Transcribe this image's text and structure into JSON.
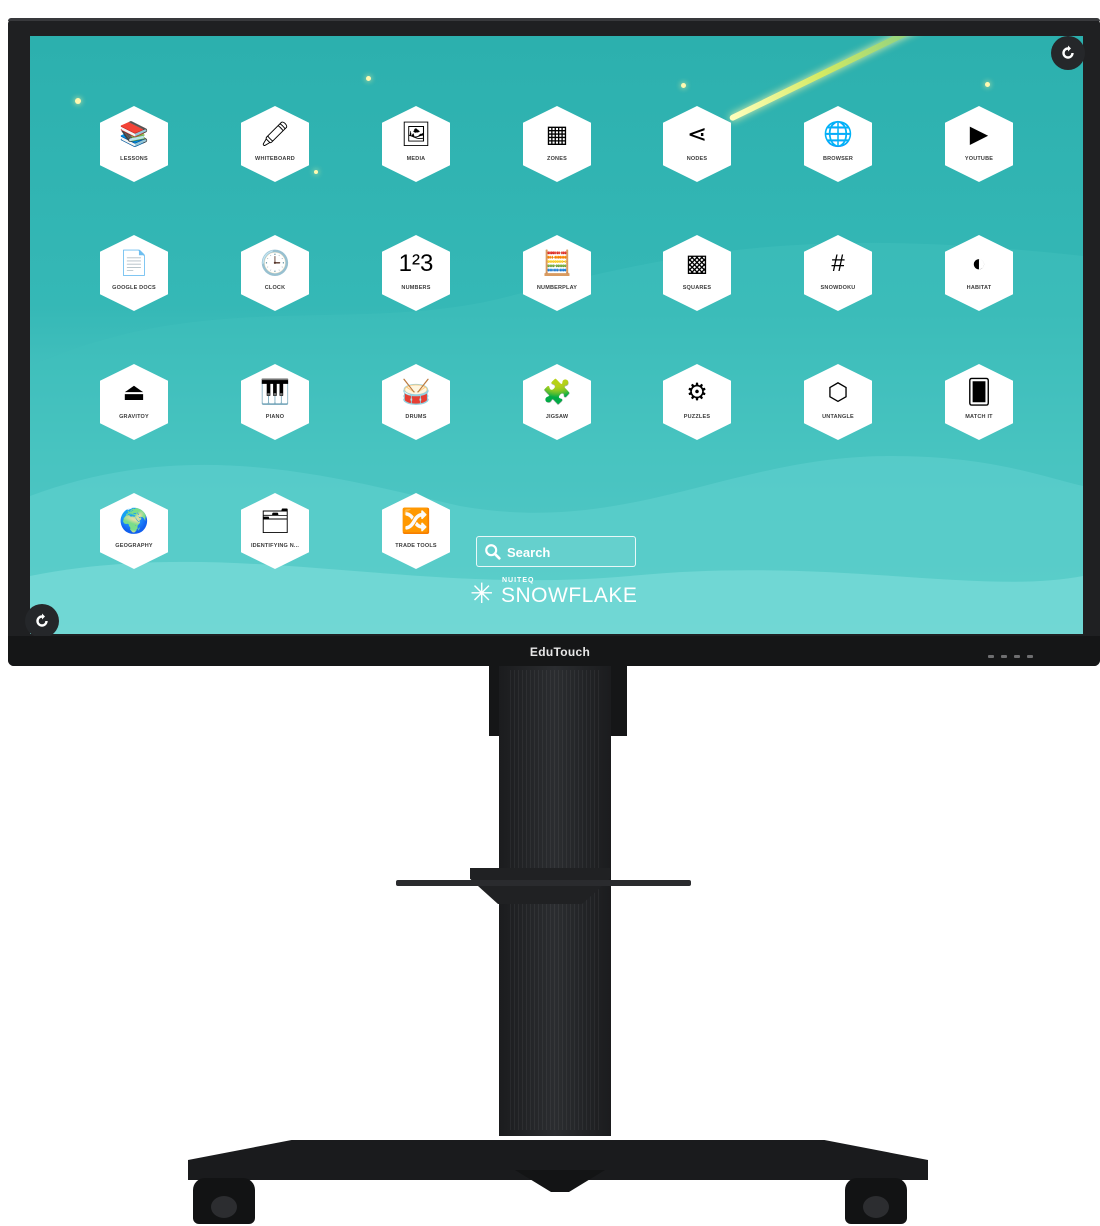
{
  "device": {
    "brand": "EduTouch"
  },
  "apps": [
    {
      "label": "LESSONS",
      "icon": "books-icon",
      "glyph": "📚"
    },
    {
      "label": "WHITEBOARD",
      "icon": "marker-icon",
      "glyph": "🖍"
    },
    {
      "label": "MEDIA",
      "icon": "picture-frame-icon",
      "glyph": "🖼"
    },
    {
      "label": "ZONES",
      "icon": "zones-grid-icon",
      "glyph": "▦"
    },
    {
      "label": "NODES",
      "icon": "share-nodes-icon",
      "glyph": "⋖"
    },
    {
      "label": "BROWSER",
      "icon": "globe-icon",
      "glyph": "🌐"
    },
    {
      "label": "YOUTUBE",
      "icon": "youtube-icon",
      "glyph": "▶"
    },
    {
      "label": "GOOGLE DOCS",
      "icon": "document-icon",
      "glyph": "📄"
    },
    {
      "label": "CLOCK",
      "icon": "clock-icon",
      "glyph": "🕒"
    },
    {
      "label": "NUMBERS",
      "icon": "numbers-123-icon",
      "glyph": "1²3"
    },
    {
      "label": "NUMBERPLAY",
      "icon": "calculator-icon",
      "glyph": "🧮"
    },
    {
      "label": "SQUARES",
      "icon": "squares-grid-icon",
      "glyph": "▩"
    },
    {
      "label": "SNOWDOKU",
      "icon": "sudoku-grid-icon",
      "glyph": "#"
    },
    {
      "label": "HABITAT",
      "icon": "habitat-icon",
      "glyph": "◐"
    },
    {
      "label": "GRAVITOY",
      "icon": "weight-icon",
      "glyph": "⏏"
    },
    {
      "label": "PIANO",
      "icon": "piano-keys-icon",
      "glyph": "🎹"
    },
    {
      "label": "DRUMS",
      "icon": "drum-icon",
      "glyph": "🥁"
    },
    {
      "label": "JIGSAW",
      "icon": "puzzle-piece-icon",
      "glyph": "🧩"
    },
    {
      "label": "PUZZLES",
      "icon": "gears-icon",
      "glyph": "⚙"
    },
    {
      "label": "UNTANGLE",
      "icon": "network-icon",
      "glyph": "⬡"
    },
    {
      "label": "MATCH IT",
      "icon": "cards-icon",
      "glyph": "🂠"
    },
    {
      "label": "GEOGRAPHY",
      "icon": "globe-stand-icon",
      "glyph": "🌍"
    },
    {
      "label": "IDENTIFYING N...",
      "icon": "flashcards-icon",
      "glyph": "🗂"
    },
    {
      "label": "TRADE TOOLS",
      "icon": "trade-tools-icon",
      "glyph": "🔀"
    }
  ],
  "search": {
    "placeholder": "Search"
  },
  "logo": {
    "small": "NUITEQ",
    "big": "SNOWFLAKE",
    "star_glyph": "✳"
  },
  "colors": {
    "screen_top": "#2cb0ae",
    "screen_bottom": "#6ed6d3",
    "bezel": "#1f2022",
    "tile": "#ffffff"
  }
}
